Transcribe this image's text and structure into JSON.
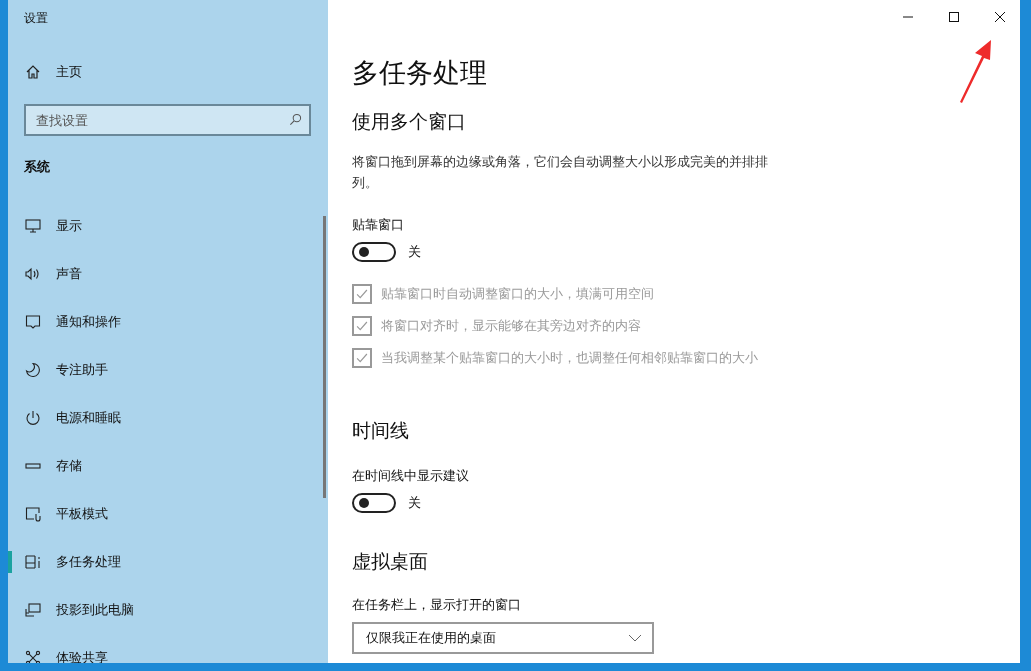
{
  "window": {
    "title": "设置"
  },
  "sidebar": {
    "home": {
      "label": "主页"
    },
    "search": {
      "placeholder": "查找设置"
    },
    "section": "系统",
    "items": [
      {
        "label": "显示",
        "selected": false
      },
      {
        "label": "声音",
        "selected": false
      },
      {
        "label": "通知和操作",
        "selected": false
      },
      {
        "label": "专注助手",
        "selected": false
      },
      {
        "label": "电源和睡眠",
        "selected": false
      },
      {
        "label": "存储",
        "selected": false
      },
      {
        "label": "平板模式",
        "selected": false
      },
      {
        "label": "多任务处理",
        "selected": true
      },
      {
        "label": "投影到此电脑",
        "selected": false
      },
      {
        "label": "体验共享",
        "selected": false
      }
    ]
  },
  "page": {
    "title": "多任务处理",
    "sections": [
      {
        "heading": "使用多个窗口",
        "description": "将窗口拖到屏幕的边缘或角落，它们会自动调整大小以形成完美的并排排列。",
        "settings": [
          {
            "kind": "toggle",
            "label": "贴靠窗口",
            "on": false,
            "state_text": "关"
          },
          {
            "kind": "checkbox",
            "label": "贴靠窗口时自动调整窗口的大小，填满可用空间",
            "checked": true,
            "disabled": true
          },
          {
            "kind": "checkbox",
            "label": "将窗口对齐时，显示能够在其旁边对齐的内容",
            "checked": true,
            "disabled": true
          },
          {
            "kind": "checkbox",
            "label": "当我调整某个贴靠窗口的大小时，也调整任何相邻贴靠窗口的大小",
            "checked": true,
            "disabled": true
          }
        ]
      },
      {
        "heading": "时间线",
        "settings": [
          {
            "kind": "toggle",
            "label": "在时间线中显示建议",
            "on": false,
            "state_text": "关"
          }
        ]
      },
      {
        "heading": "虚拟桌面",
        "settings": [
          {
            "kind": "dropdown",
            "label": "在任务栏上，显示打开的窗口",
            "value": "仅限我正在使用的桌面"
          }
        ]
      }
    ]
  }
}
